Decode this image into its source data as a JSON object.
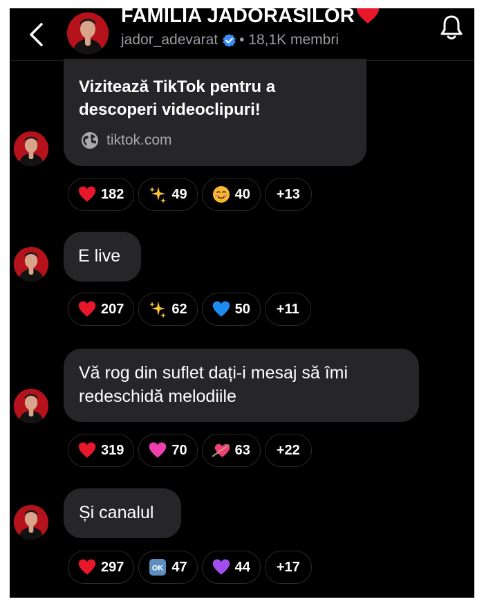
{
  "header": {
    "title": "FAMILIA JADORASILOR",
    "username": "jador_adevarat",
    "members": "• 18,1K membri"
  },
  "messages": [
    {
      "type": "link",
      "link_title": "Vizitează TikTok pentru a descoperi videoclipuri!",
      "link_domain": "tiktok.com",
      "reactions": [
        {
          "icon": "red-heart",
          "count": "182"
        },
        {
          "icon": "sparkles",
          "count": "49"
        },
        {
          "icon": "smiling-face",
          "count": "40"
        }
      ],
      "more": "+13"
    },
    {
      "type": "text",
      "text": "E live",
      "reactions": [
        {
          "icon": "red-heart",
          "count": "207"
        },
        {
          "icon": "sparkles",
          "count": "62"
        },
        {
          "icon": "blue-heart",
          "count": "50"
        }
      ],
      "more": "+11"
    },
    {
      "type": "text",
      "text": "Vă rog din suflet dați-i mesaj să îmi redeschidă melodiile",
      "reactions": [
        {
          "icon": "red-heart",
          "count": "319"
        },
        {
          "icon": "pink-heart",
          "count": "70"
        },
        {
          "icon": "heart-with-arrow",
          "count": "63"
        }
      ],
      "more": "+22"
    },
    {
      "type": "text",
      "text": "Și canalul",
      "reactions": [
        {
          "icon": "red-heart",
          "count": "297"
        },
        {
          "icon": "ok-button",
          "count": "47",
          "label": "OK"
        },
        {
          "icon": "purple-heart",
          "count": "44"
        }
      ],
      "more": "+17"
    }
  ],
  "colors": {
    "background": "#000000",
    "bubble": "#262629",
    "secondary_text": "#9a9aa2",
    "verified": "#3b8cf5",
    "avatar": "#b5121b"
  }
}
